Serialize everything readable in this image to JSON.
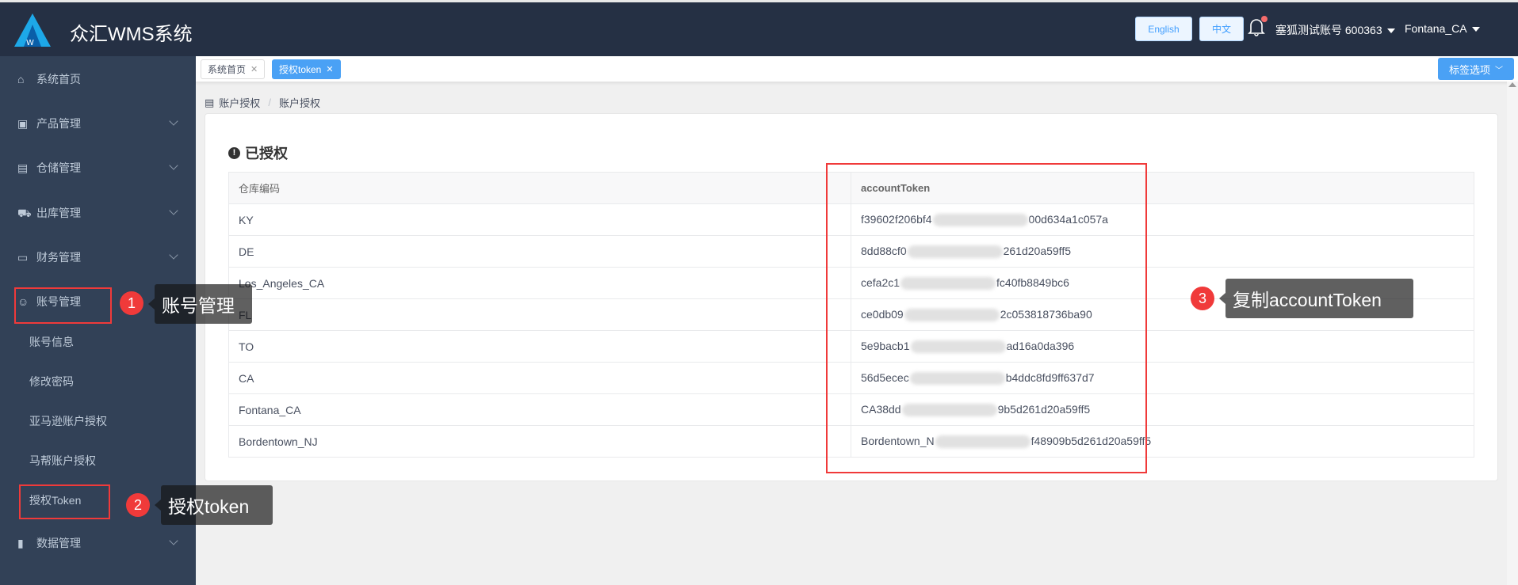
{
  "header": {
    "title": "众汇WMS系统",
    "lang_en": "English",
    "lang_zh": "中文",
    "account": "塞狐测试账号 600363",
    "warehouse": "Fontana_CA"
  },
  "sidebar": {
    "items": [
      {
        "label": "系统首页",
        "icon": "home-icon"
      },
      {
        "label": "产品管理",
        "icon": "box-icon"
      },
      {
        "label": "仓储管理",
        "icon": "building-icon"
      },
      {
        "label": "出库管理",
        "icon": "truck-icon"
      },
      {
        "label": "财务管理",
        "icon": "finance-icon"
      },
      {
        "label": "账号管理",
        "icon": "user-icon"
      }
    ],
    "sub_items": [
      "账号信息",
      "修改密码",
      "亚马逊账户授权",
      "马帮账户授权",
      "授权Token"
    ],
    "last_item": {
      "label": "数据管理",
      "icon": "bar-chart-icon"
    }
  },
  "tabs": [
    {
      "label": "系统首页"
    },
    {
      "label": "授权token"
    }
  ],
  "tab_options": "标签选项",
  "breadcrumb": [
    "账户授权",
    "账户授权"
  ],
  "card": {
    "title": "已授权",
    "columns": [
      "仓库编码",
      "accountToken"
    ],
    "rows": [
      {
        "code": "KY",
        "token_start": "f39602f206bf4",
        "token_end": "00d634a1c057a"
      },
      {
        "code": "DE",
        "token_start": "8dd88cf0",
        "token_end": "261d20a59ff5"
      },
      {
        "code": "Los_Angeles_CA",
        "token_start": "cefa2c1",
        "token_end": "fc40fb8849bc6"
      },
      {
        "code": "FL",
        "token_start": "ce0db09",
        "token_end": "2c053818736ba90"
      },
      {
        "code": "TO",
        "token_start": "5e9bacb1",
        "token_end": "ad16a0da396"
      },
      {
        "code": "CA",
        "token_start": "56d5ecec",
        "token_end": "b4ddc8fd9ff637d7"
      },
      {
        "code": "Fontana_CA",
        "token_start": "CA38dd",
        "token_end": "9b5d261d20a59ff5"
      },
      {
        "code": "Bordentown_NJ",
        "token_start": "Bordentown_N",
        "token_end": "f48909b5d261d20a59ff5"
      }
    ]
  },
  "annotations": [
    {
      "num": "1",
      "text": "账号管理"
    },
    {
      "num": "2",
      "text": "授权token"
    },
    {
      "num": "3",
      "text": "复制accountToken"
    }
  ],
  "colors": {
    "header": "#253044",
    "sidebar": "#324157",
    "accent": "#4aa1f5",
    "annotation": "#f03a3a"
  }
}
